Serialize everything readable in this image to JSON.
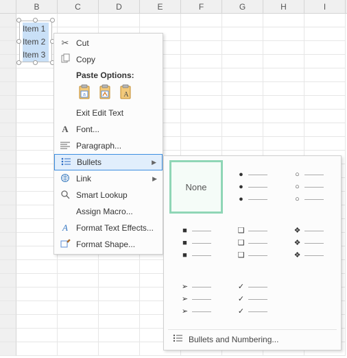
{
  "columns": [
    "B",
    "C",
    "D",
    "E",
    "F",
    "G",
    "H",
    "I"
  ],
  "textbox": {
    "items": [
      "Item 1",
      "Item 2",
      "Item 3"
    ]
  },
  "menu": {
    "cut": "Cut",
    "copy": "Copy",
    "paste_options": "Paste Options:",
    "exit_edit_text": "Exit Edit Text",
    "font": "Font...",
    "paragraph": "Paragraph...",
    "bullets": "Bullets",
    "link": "Link",
    "smart_lookup": "Smart Lookup",
    "assign_macro": "Assign Macro...",
    "format_text_effects": "Format Text Effects...",
    "format_shape": "Format Shape..."
  },
  "gallery": {
    "none": "None",
    "footer": "Bullets and Numbering..."
  }
}
